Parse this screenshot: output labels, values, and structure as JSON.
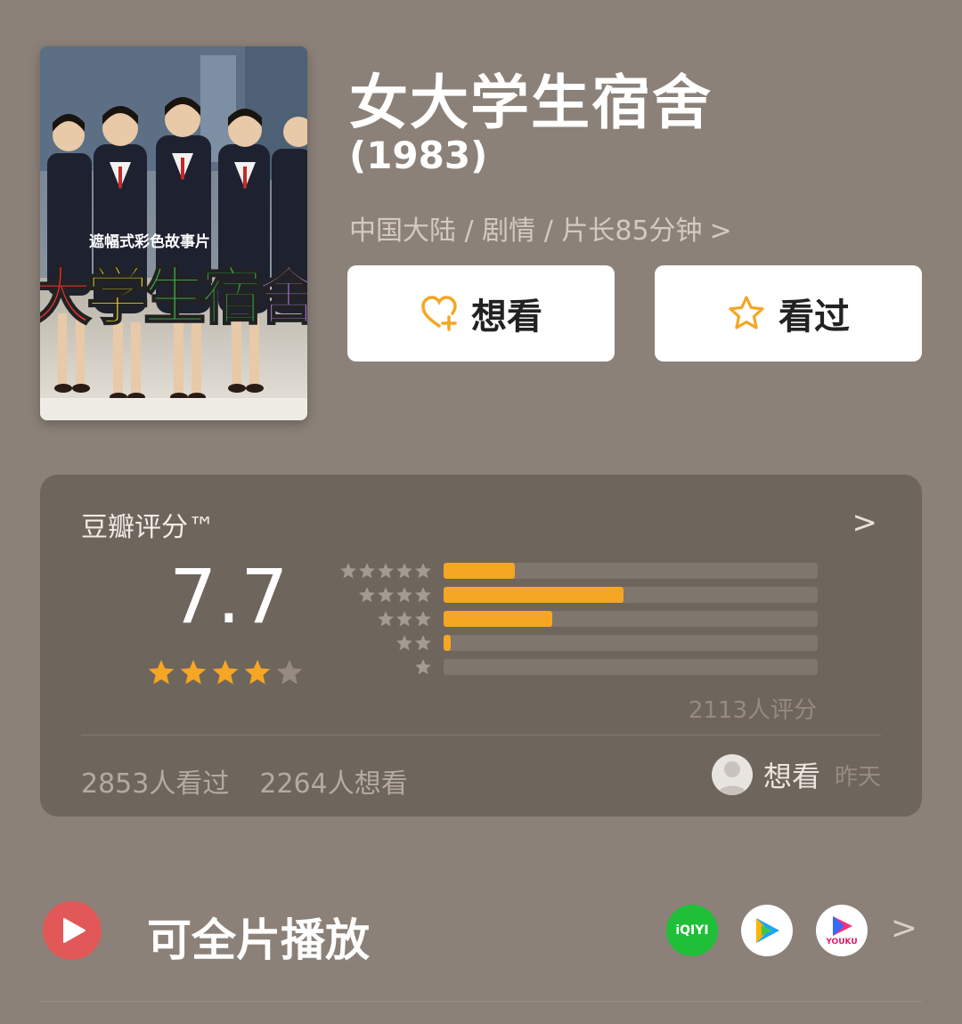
{
  "movie": {
    "title": "女大学生宿舍",
    "year": "(1983)",
    "meta": "中国大陆 / 剧情 / 片长85分钟",
    "meta_chevron": ">",
    "poster": {
      "tagline": "遮幅式彩色故事片",
      "title_text": "大学生宿舍",
      "title_colors": [
        "#e23030",
        "#f3e33a",
        "#3fb34f",
        "#2fa04a",
        "#9a6fd0"
      ]
    }
  },
  "actions": {
    "want_label": "想看",
    "seen_label": "看过",
    "want_icon": "heart-plus-icon",
    "seen_icon": "star-outline-icon",
    "accent": "#f5a623"
  },
  "rating": {
    "label": "豆瓣评分™",
    "arrow": ">",
    "score": "7.7",
    "stars_filled": 4,
    "stars_total": 5,
    "distribution": [
      {
        "stars": 5,
        "fraction": 0.19
      },
      {
        "stars": 4,
        "fraction": 0.48
      },
      {
        "stars": 3,
        "fraction": 0.29
      },
      {
        "stars": 2,
        "fraction": 0.02
      },
      {
        "stars": 1,
        "fraction": 0.0
      }
    ],
    "raters": "2113人评分",
    "seen_count": "2853人看过",
    "want_count": "2264人想看",
    "friend_action": "想看",
    "friend_time": "昨天"
  },
  "play": {
    "label": "可全片播放",
    "arrow": ">",
    "platforms": [
      {
        "name": "iqiyi",
        "text": "iQIYI"
      },
      {
        "name": "tencent-video",
        "text": ""
      },
      {
        "name": "youku",
        "text": "YOUKU"
      }
    ]
  }
}
